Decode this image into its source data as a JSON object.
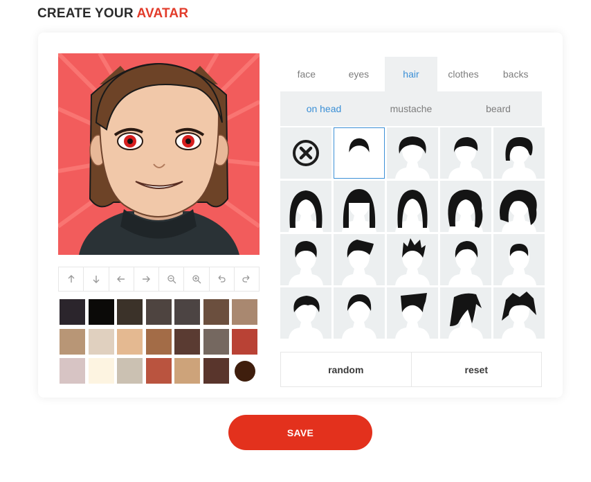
{
  "title": {
    "prefix": "CREATE YOUR",
    "accent": "AVATAR"
  },
  "tabs": [
    {
      "label": "face",
      "active": false
    },
    {
      "label": "eyes",
      "active": false
    },
    {
      "label": "hair",
      "active": true
    },
    {
      "label": "clothes",
      "active": false
    },
    {
      "label": "backs",
      "active": false
    }
  ],
  "subtabs": [
    {
      "label": "on head",
      "active": true
    },
    {
      "label": "mustache",
      "active": false
    },
    {
      "label": "beard",
      "active": false
    }
  ],
  "toolbar": [
    {
      "name": "move-up-button",
      "icon": "arrow-up-icon"
    },
    {
      "name": "move-down-button",
      "icon": "arrow-down-icon"
    },
    {
      "name": "move-left-button",
      "icon": "arrow-left-icon"
    },
    {
      "name": "move-right-button",
      "icon": "arrow-right-icon"
    },
    {
      "name": "zoom-out-button",
      "icon": "zoom-out-icon"
    },
    {
      "name": "zoom-in-button",
      "icon": "zoom-in-icon"
    },
    {
      "name": "undo-button",
      "icon": "undo-icon"
    },
    {
      "name": "redo-button",
      "icon": "redo-icon"
    }
  ],
  "colors": {
    "accent": "#e3311d",
    "tab_active_text": "#3a8fd6",
    "preview_background": "#f25c5c"
  },
  "swatches": [
    "#2b252c",
    "#0b0a08",
    "#3b3229",
    "#4e4440",
    "#4c4443",
    "#6b4f3e",
    "#a98870",
    "#b89676",
    "#e0d0bf",
    "#e4b991",
    "#a36c47",
    "#5a3b32",
    "#756860",
    "#b94235",
    "#d7c4c4",
    "#fdf4e1",
    "#cbc1b2",
    "#ba543f",
    "#cda37a",
    "#59352c",
    "#3f1e0d"
  ],
  "selected_swatch_index": 20,
  "hair_styles": [
    {
      "id": "none",
      "label": "none"
    },
    {
      "id": "short-crop"
    },
    {
      "id": "curly-short"
    },
    {
      "id": "side-part"
    },
    {
      "id": "wavy-bob"
    },
    {
      "id": "long-straight"
    },
    {
      "id": "bangs-long"
    },
    {
      "id": "long-center"
    },
    {
      "id": "long-wavy"
    },
    {
      "id": "curly-long"
    },
    {
      "id": "quiff"
    },
    {
      "id": "pompadour"
    },
    {
      "id": "spiky"
    },
    {
      "id": "brush-up"
    },
    {
      "id": "crew"
    },
    {
      "id": "messy-short"
    },
    {
      "id": "slick-back"
    },
    {
      "id": "tall-quiff"
    },
    {
      "id": "emo"
    },
    {
      "id": "shaggy"
    }
  ],
  "selected_hair_index": 1,
  "actions": {
    "random": "random",
    "reset": "reset"
  },
  "save_label": "SAVE"
}
